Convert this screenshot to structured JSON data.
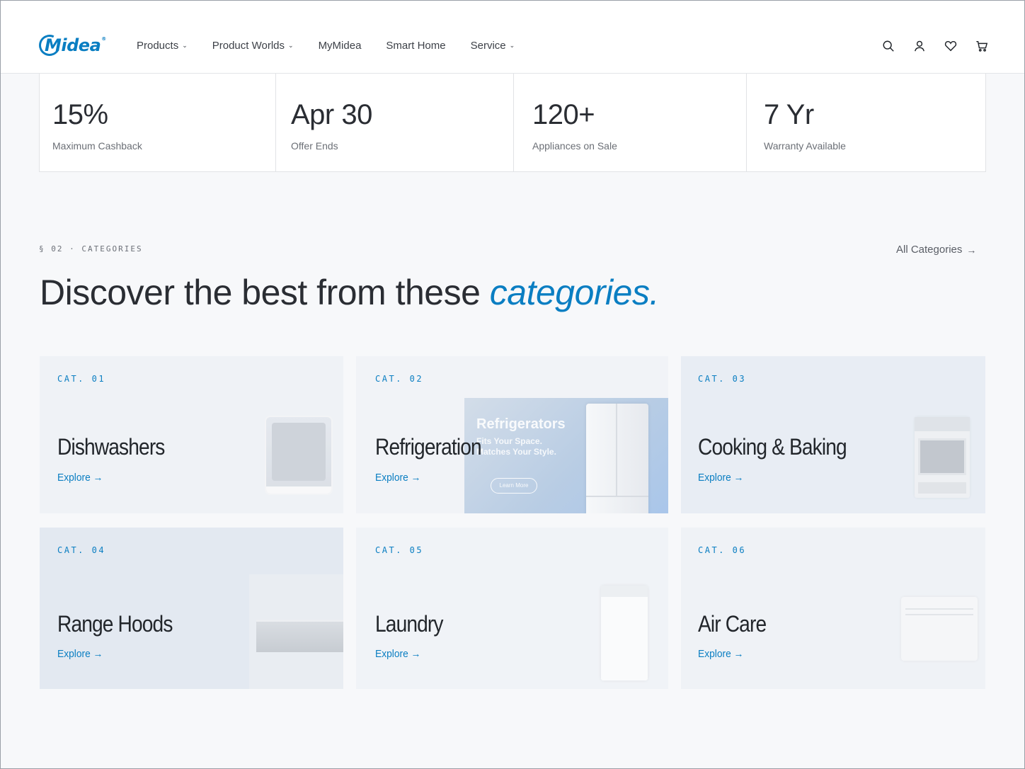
{
  "brand": {
    "name": "Midea"
  },
  "nav": {
    "items": [
      {
        "label": "Products",
        "has_dropdown": true
      },
      {
        "label": "Product Worlds",
        "has_dropdown": true
      },
      {
        "label": "MyMidea",
        "has_dropdown": false
      },
      {
        "label": "Smart Home",
        "has_dropdown": false
      },
      {
        "label": "Service",
        "has_dropdown": true
      }
    ],
    "icons": [
      "search-icon",
      "user-icon",
      "heart-icon",
      "cart-icon"
    ]
  },
  "stats": [
    {
      "value": "15%",
      "label": "Maximum Cashback"
    },
    {
      "value": "Apr 30",
      "label": "Offer Ends"
    },
    {
      "value": "120+",
      "label": "Appliances on Sale"
    },
    {
      "value": "7 Yr",
      "label": "Warranty Available"
    }
  ],
  "section": {
    "eyebrow": "§ 02 · CATEGORIES",
    "headline_prefix": "Discover the best from these ",
    "headline_accent": "categories.",
    "all_link": "All Categories",
    "arrow": "→"
  },
  "categories": [
    {
      "cat": "CAT. 01",
      "title": "Dishwashers",
      "cta": "Explore →"
    },
    {
      "cat": "CAT. 02",
      "title": "Refrigeration",
      "cta": "Explore →",
      "promo": {
        "title": "Refrigerators",
        "subtitle": "Fits Your Space. Matches Your Style.",
        "button": "Learn More"
      }
    },
    {
      "cat": "CAT. 03",
      "title": "Cooking & Baking",
      "cta": "Explore →"
    },
    {
      "cat": "CAT. 04",
      "title": "Range Hoods",
      "cta": "Explore →"
    },
    {
      "cat": "CAT. 05",
      "title": "Laundry",
      "cta": "Explore →"
    },
    {
      "cat": "CAT. 06",
      "title": "Air Care",
      "cta": "Explore →"
    }
  ],
  "colors": {
    "accent": "#0a7ec2",
    "card_bg": "#eef1f6",
    "text": "#2a2d33"
  }
}
